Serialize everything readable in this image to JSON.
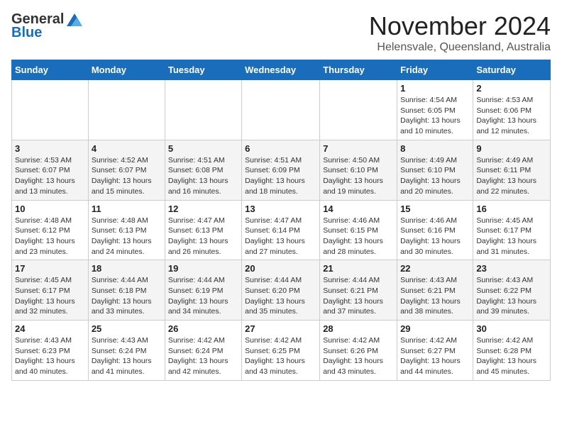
{
  "header": {
    "logo_line1": "General",
    "logo_line2": "Blue",
    "main_title": "November 2024",
    "subtitle": "Helensvale, Queensland, Australia"
  },
  "weekdays": [
    "Sunday",
    "Monday",
    "Tuesday",
    "Wednesday",
    "Thursday",
    "Friday",
    "Saturday"
  ],
  "weeks": [
    [
      {
        "day": "",
        "info": ""
      },
      {
        "day": "",
        "info": ""
      },
      {
        "day": "",
        "info": ""
      },
      {
        "day": "",
        "info": ""
      },
      {
        "day": "",
        "info": ""
      },
      {
        "day": "1",
        "info": "Sunrise: 4:54 AM\nSunset: 6:05 PM\nDaylight: 13 hours and 10 minutes."
      },
      {
        "day": "2",
        "info": "Sunrise: 4:53 AM\nSunset: 6:06 PM\nDaylight: 13 hours and 12 minutes."
      }
    ],
    [
      {
        "day": "3",
        "info": "Sunrise: 4:53 AM\nSunset: 6:07 PM\nDaylight: 13 hours and 13 minutes."
      },
      {
        "day": "4",
        "info": "Sunrise: 4:52 AM\nSunset: 6:07 PM\nDaylight: 13 hours and 15 minutes."
      },
      {
        "day": "5",
        "info": "Sunrise: 4:51 AM\nSunset: 6:08 PM\nDaylight: 13 hours and 16 minutes."
      },
      {
        "day": "6",
        "info": "Sunrise: 4:51 AM\nSunset: 6:09 PM\nDaylight: 13 hours and 18 minutes."
      },
      {
        "day": "7",
        "info": "Sunrise: 4:50 AM\nSunset: 6:10 PM\nDaylight: 13 hours and 19 minutes."
      },
      {
        "day": "8",
        "info": "Sunrise: 4:49 AM\nSunset: 6:10 PM\nDaylight: 13 hours and 20 minutes."
      },
      {
        "day": "9",
        "info": "Sunrise: 4:49 AM\nSunset: 6:11 PM\nDaylight: 13 hours and 22 minutes."
      }
    ],
    [
      {
        "day": "10",
        "info": "Sunrise: 4:48 AM\nSunset: 6:12 PM\nDaylight: 13 hours and 23 minutes."
      },
      {
        "day": "11",
        "info": "Sunrise: 4:48 AM\nSunset: 6:13 PM\nDaylight: 13 hours and 24 minutes."
      },
      {
        "day": "12",
        "info": "Sunrise: 4:47 AM\nSunset: 6:13 PM\nDaylight: 13 hours and 26 minutes."
      },
      {
        "day": "13",
        "info": "Sunrise: 4:47 AM\nSunset: 6:14 PM\nDaylight: 13 hours and 27 minutes."
      },
      {
        "day": "14",
        "info": "Sunrise: 4:46 AM\nSunset: 6:15 PM\nDaylight: 13 hours and 28 minutes."
      },
      {
        "day": "15",
        "info": "Sunrise: 4:46 AM\nSunset: 6:16 PM\nDaylight: 13 hours and 30 minutes."
      },
      {
        "day": "16",
        "info": "Sunrise: 4:45 AM\nSunset: 6:17 PM\nDaylight: 13 hours and 31 minutes."
      }
    ],
    [
      {
        "day": "17",
        "info": "Sunrise: 4:45 AM\nSunset: 6:17 PM\nDaylight: 13 hours and 32 minutes."
      },
      {
        "day": "18",
        "info": "Sunrise: 4:44 AM\nSunset: 6:18 PM\nDaylight: 13 hours and 33 minutes."
      },
      {
        "day": "19",
        "info": "Sunrise: 4:44 AM\nSunset: 6:19 PM\nDaylight: 13 hours and 34 minutes."
      },
      {
        "day": "20",
        "info": "Sunrise: 4:44 AM\nSunset: 6:20 PM\nDaylight: 13 hours and 35 minutes."
      },
      {
        "day": "21",
        "info": "Sunrise: 4:44 AM\nSunset: 6:21 PM\nDaylight: 13 hours and 37 minutes."
      },
      {
        "day": "22",
        "info": "Sunrise: 4:43 AM\nSunset: 6:21 PM\nDaylight: 13 hours and 38 minutes."
      },
      {
        "day": "23",
        "info": "Sunrise: 4:43 AM\nSunset: 6:22 PM\nDaylight: 13 hours and 39 minutes."
      }
    ],
    [
      {
        "day": "24",
        "info": "Sunrise: 4:43 AM\nSunset: 6:23 PM\nDaylight: 13 hours and 40 minutes."
      },
      {
        "day": "25",
        "info": "Sunrise: 4:43 AM\nSunset: 6:24 PM\nDaylight: 13 hours and 41 minutes."
      },
      {
        "day": "26",
        "info": "Sunrise: 4:42 AM\nSunset: 6:24 PM\nDaylight: 13 hours and 42 minutes."
      },
      {
        "day": "27",
        "info": "Sunrise: 4:42 AM\nSunset: 6:25 PM\nDaylight: 13 hours and 43 minutes."
      },
      {
        "day": "28",
        "info": "Sunrise: 4:42 AM\nSunset: 6:26 PM\nDaylight: 13 hours and 43 minutes."
      },
      {
        "day": "29",
        "info": "Sunrise: 4:42 AM\nSunset: 6:27 PM\nDaylight: 13 hours and 44 minutes."
      },
      {
        "day": "30",
        "info": "Sunrise: 4:42 AM\nSunset: 6:28 PM\nDaylight: 13 hours and 45 minutes."
      }
    ]
  ]
}
